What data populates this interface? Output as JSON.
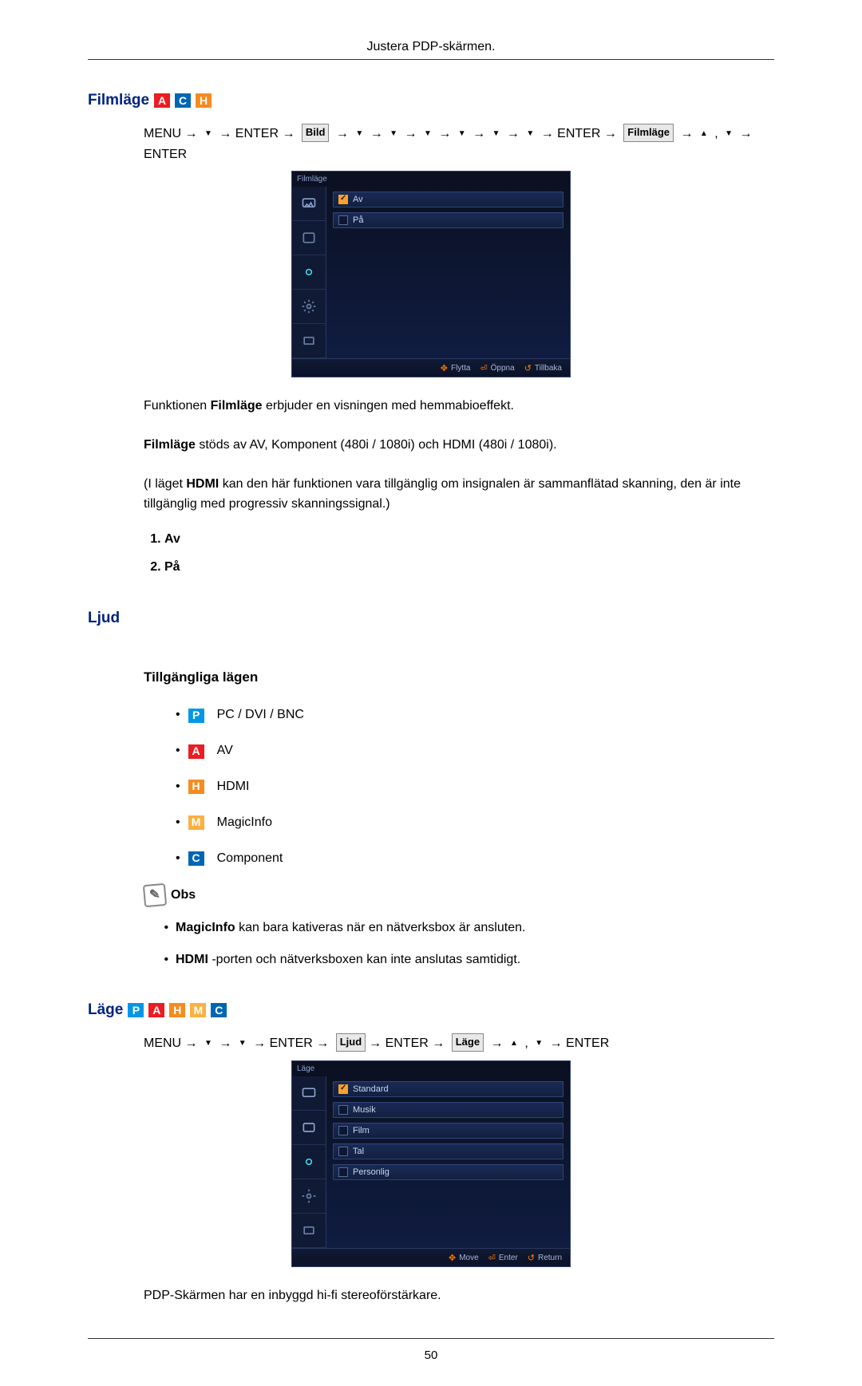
{
  "header": {
    "title": "Justera PDP-skärmen."
  },
  "filmlage": {
    "title": "Filmläge",
    "nav_menu": "MENU",
    "nav_enter": "ENTER",
    "label_bild": "Bild",
    "label_filmlage": "Filmläge",
    "osd": {
      "top_label": "Filmläge",
      "rows": [
        {
          "label": "Av",
          "selected": true
        },
        {
          "label": "På",
          "selected": false
        }
      ],
      "footer": {
        "move": "Flytta",
        "open": "Öppna",
        "back": "Tillbaka"
      }
    },
    "p1_a": "Funktionen ",
    "p1_b": "Filmläge",
    "p1_c": " erbjuder en visningen med hemmabioeffekt.",
    "p2_a": "Filmläge",
    "p2_b": " stöds av AV, Komponent (480i / 1080i) och HDMI (480i / 1080i).",
    "p3_a": "(I läget ",
    "p3_b": "HDMI",
    "p3_c": " kan den här funktionen vara tillgänglig om insignalen är sammanflätad skanning, den är inte tillgänglig med progressiv skanningssignal.)",
    "list": {
      "i1": "Av",
      "i2": "På"
    }
  },
  "ljud": {
    "title": "Ljud",
    "sub": "Tillgängliga lägen",
    "modes": {
      "pc": "PC / DVI / BNC",
      "av": "AV",
      "hdmi": "HDMI",
      "magic": "MagicInfo",
      "comp": "Component"
    },
    "note_label": "Obs",
    "n1_a": "MagicInfo",
    "n1_b": " kan bara kativeras när en nätverksbox är ansluten.",
    "n2_a": "HDMI",
    "n2_b": " -porten och nätverksboxen kan inte anslutas samtidigt."
  },
  "lage": {
    "title": "Läge",
    "nav_menu": "MENU",
    "nav_enter": "ENTER",
    "label_ljud": "Ljud",
    "label_lage": "Läge",
    "osd": {
      "top_label": "Läge",
      "rows": [
        {
          "label": "Standard",
          "selected": true
        },
        {
          "label": "Musik",
          "selected": false
        },
        {
          "label": "Film",
          "selected": false
        },
        {
          "label": "Tal",
          "selected": false
        },
        {
          "label": "Personlig",
          "selected": false
        }
      ],
      "footer": {
        "move": "Move",
        "enter": "Enter",
        "return": "Return"
      }
    },
    "p1": "PDP-Skärmen har en inbyggd hi-fi stereoförstärkare."
  },
  "page_number": "50"
}
